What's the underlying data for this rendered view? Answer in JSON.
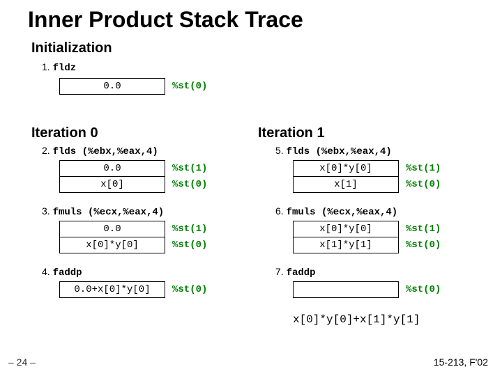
{
  "title": "Inner Product Stack Trace",
  "sections": {
    "init": {
      "heading": "Initialization"
    },
    "iter0": {
      "heading": "Iteration 0"
    },
    "iter1": {
      "heading": "Iteration 1"
    }
  },
  "steps": {
    "s1": {
      "num": "1.",
      "instr": "fldz"
    },
    "s2": {
      "num": "2.",
      "instr": "flds (%ebx,%eax,4)"
    },
    "s3": {
      "num": "3.",
      "instr": "fmuls (%ecx,%eax,4)"
    },
    "s4": {
      "num": "4.",
      "instr": "faddp"
    },
    "s5": {
      "num": "5.",
      "instr": "flds (%ebx,%eax,4)"
    },
    "s6": {
      "num": "6.",
      "instr": "fmuls (%ecx,%eax,4)"
    },
    "s7": {
      "num": "7.",
      "instr": "faddp"
    }
  },
  "stacks": {
    "st1": {
      "cells": [
        "0.0"
      ],
      "labels": [
        "%st(0)"
      ]
    },
    "st2": {
      "cells": [
        "0.0",
        "x[0]"
      ],
      "labels": [
        "%st(1)",
        "%st(0)"
      ]
    },
    "st3": {
      "cells": [
        "0.0",
        "x[0]*y[0]"
      ],
      "labels": [
        "%st(1)",
        "%st(0)"
      ]
    },
    "st4": {
      "cells": [
        "0.0+x[0]*y[0]"
      ],
      "labels": [
        "%st(0)"
      ]
    },
    "st5": {
      "cells": [
        "x[0]*y[0]",
        "x[1]"
      ],
      "labels": [
        "%st(1)",
        "%st(0)"
      ]
    },
    "st6": {
      "cells": [
        "x[0]*y[0]",
        "x[1]*y[1]"
      ],
      "labels": [
        "%st(1)",
        "%st(0)"
      ]
    },
    "st7": {
      "cells": [
        ""
      ],
      "labels": [
        "%st(0)"
      ]
    }
  },
  "result": "x[0]*y[0]+x[1]*y[1]",
  "footer": {
    "left": "– 24 –",
    "right": "15-213, F'02"
  }
}
